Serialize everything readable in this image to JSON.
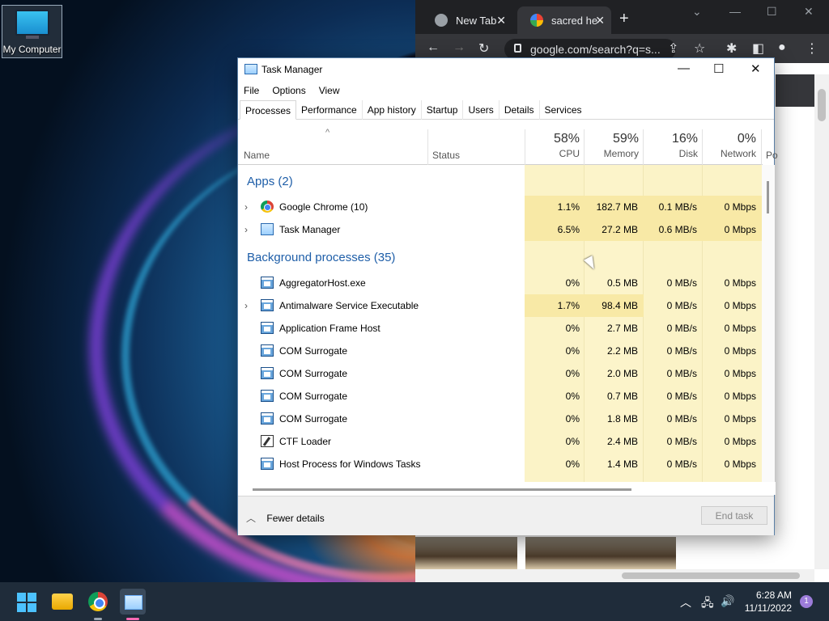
{
  "desktop": {
    "icon_label": "My Computer"
  },
  "chrome": {
    "tabs": [
      {
        "label": "New Tab",
        "close": "✕"
      },
      {
        "label": "sacred he",
        "close": "✕"
      }
    ],
    "new_tab": "+",
    "window_controls": [
      "⌄",
      "—",
      "☐",
      "✕"
    ],
    "nav": {
      "back": "←",
      "forward": "→",
      "reload": "↻"
    },
    "omnibox": "google.com/search?q=s...",
    "toolbar_icons": [
      "⇪",
      "☆",
      "✱",
      "◧",
      "●",
      "⋮"
    ]
  },
  "task_manager": {
    "title": "Task Manager",
    "window_controls": {
      "minimize": "—",
      "maximize": "☐",
      "close": "✕"
    },
    "menu": [
      "File",
      "Options",
      "View"
    ],
    "tabs": [
      "Processes",
      "Performance",
      "App history",
      "Startup",
      "Users",
      "Details",
      "Services"
    ],
    "sort_arrow": "^",
    "columns": {
      "name": "Name",
      "status": "Status",
      "cpu": {
        "pct": "58%",
        "label": "CPU"
      },
      "memory": {
        "pct": "59%",
        "label": "Memory"
      },
      "disk": {
        "pct": "16%",
        "label": "Disk"
      },
      "network": {
        "pct": "0%",
        "label": "Network"
      },
      "power": "Po"
    },
    "groups": {
      "apps": "Apps (2)",
      "background": "Background processes (35)"
    },
    "apps": [
      {
        "name": "Google Chrome (10)",
        "icon": "chrome-icon",
        "expandable": true,
        "cpu": "1.1%",
        "memory": "182.7 MB",
        "disk": "0.1 MB/s",
        "network": "0 Mbps"
      },
      {
        "name": "Task Manager",
        "icon": "task-manager-icon",
        "expandable": true,
        "cpu": "6.5%",
        "memory": "27.2 MB",
        "disk": "0.6 MB/s",
        "network": "0 Mbps"
      }
    ],
    "background": [
      {
        "name": "AggregatorHost.exe",
        "icon": "process-icon",
        "expandable": false,
        "cpu": "0%",
        "memory": "0.5 MB",
        "disk": "0 MB/s",
        "network": "0 Mbps"
      },
      {
        "name": "Antimalware Service Executable",
        "icon": "process-icon",
        "expandable": true,
        "cpu": "1.7%",
        "memory": "98.4 MB",
        "disk": "0 MB/s",
        "network": "0 Mbps"
      },
      {
        "name": "Application Frame Host",
        "icon": "process-icon",
        "expandable": false,
        "cpu": "0%",
        "memory": "2.7 MB",
        "disk": "0 MB/s",
        "network": "0 Mbps"
      },
      {
        "name": "COM Surrogate",
        "icon": "process-icon",
        "expandable": false,
        "cpu": "0%",
        "memory": "2.2 MB",
        "disk": "0 MB/s",
        "network": "0 Mbps"
      },
      {
        "name": "COM Surrogate",
        "icon": "process-icon",
        "expandable": false,
        "cpu": "0%",
        "memory": "2.0 MB",
        "disk": "0 MB/s",
        "network": "0 Mbps"
      },
      {
        "name": "COM Surrogate",
        "icon": "process-icon",
        "expandable": false,
        "cpu": "0%",
        "memory": "0.7 MB",
        "disk": "0 MB/s",
        "network": "0 Mbps"
      },
      {
        "name": "COM Surrogate",
        "icon": "process-icon",
        "expandable": false,
        "cpu": "0%",
        "memory": "1.8 MB",
        "disk": "0 MB/s",
        "network": "0 Mbps"
      },
      {
        "name": "CTF Loader",
        "icon": "ctf-loader-icon",
        "expandable": false,
        "cpu": "0%",
        "memory": "2.4 MB",
        "disk": "0 MB/s",
        "network": "0 Mbps"
      },
      {
        "name": "Host Process for Windows Tasks",
        "icon": "process-icon",
        "expandable": false,
        "cpu": "0%",
        "memory": "1.4 MB",
        "disk": "0 MB/s",
        "network": "0 Mbps"
      }
    ],
    "footer": {
      "fewer_details": "Fewer details",
      "end_task": "End task"
    }
  },
  "taskbar": {
    "pinned": [
      "start-icon",
      "file-explorer-icon",
      "chrome-icon",
      "task-manager-icon"
    ],
    "tray_icons": [
      "chevron-up-icon",
      "network-icon",
      "volume-icon"
    ],
    "time": "6:28 AM",
    "date": "11/11/2022",
    "notification_count": "1"
  }
}
